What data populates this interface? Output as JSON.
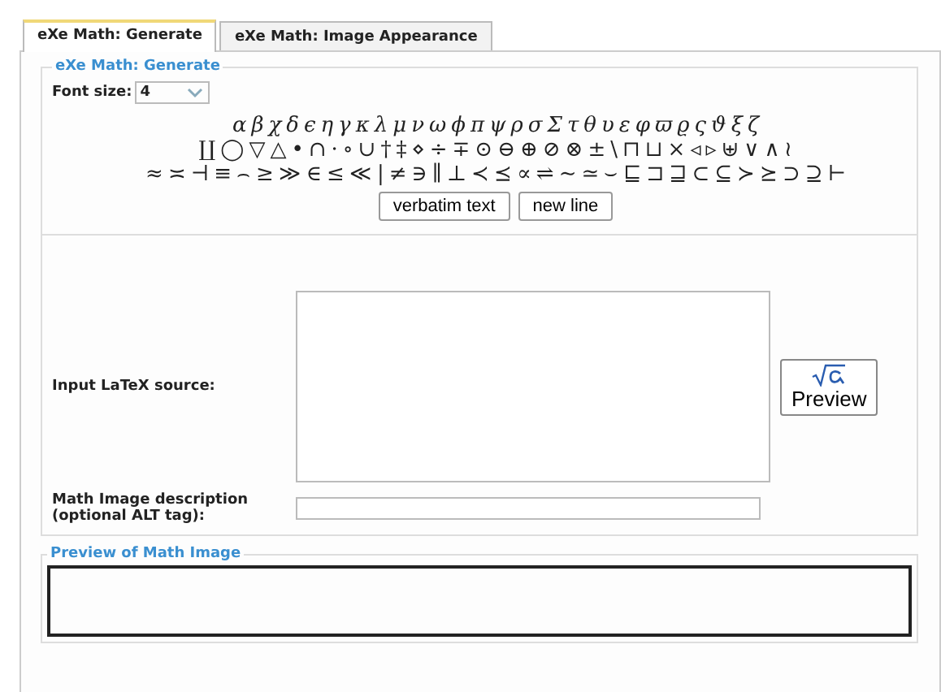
{
  "tabs": [
    {
      "label": "eXe Math: Generate",
      "selected": true
    },
    {
      "label": "eXe Math: Image Appearance",
      "selected": false
    }
  ],
  "generate": {
    "legend": "eXe Math: Generate",
    "font_size": {
      "label": "Font size:",
      "value": "4"
    },
    "symbol_rows": [
      [
        "α",
        "β",
        "χ",
        "δ",
        "ϵ",
        "η",
        "γ",
        "κ",
        "λ",
        "μ",
        "ν",
        "ω",
        "ϕ",
        "π",
        "ψ",
        "ρ",
        "σ",
        "Σ",
        "τ",
        "θ",
        "υ",
        "ε",
        "φ",
        "ϖ",
        "ϱ",
        "ς",
        "ϑ",
        "ξ",
        "ζ"
      ],
      [
        "∐",
        "◯",
        "▽",
        "△",
        "•",
        "∩",
        "·",
        "∘",
        "∪",
        "†",
        "‡",
        "⋄",
        "÷",
        "∓",
        "⊙",
        "⊖",
        "⊕",
        "⊘",
        "⊗",
        "±",
        "\\",
        "⊓",
        "⊔",
        "×",
        "◃",
        "▹",
        "⊎",
        "∨",
        "∧",
        "≀"
      ],
      [
        "≈",
        "≍",
        "⊣",
        "≡",
        "⌢",
        "≥",
        "≫",
        "∈",
        "≤",
        "≪",
        "|",
        "≠",
        "∋",
        "∥",
        "⊥",
        "≺",
        "⪯",
        "∝",
        "⇌",
        "∼",
        "≃",
        "⌣",
        "⊑",
        "⊐",
        "⊒",
        "⊂",
        "⊆",
        "≻",
        "⪰",
        "⊃",
        "⊇",
        "⊢"
      ]
    ],
    "buttons": [
      "verbatim text",
      "new line"
    ],
    "latex_label": "Input LaTeX source:",
    "preview_button": "Preview",
    "alt_label": "Math Image description (optional ALT tag):"
  },
  "preview": {
    "legend": "Preview of Math Image"
  }
}
